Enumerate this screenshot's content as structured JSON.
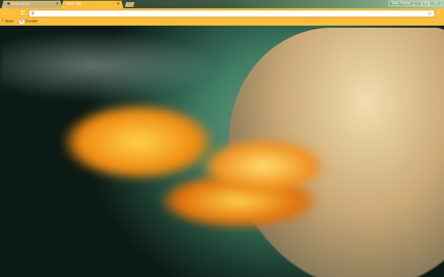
{
  "tabs": [
    {
      "title": "Extensions",
      "icon": "puzzle-icon",
      "active": false
    },
    {
      "title": "New Tab",
      "active": true
    }
  ],
  "window": {
    "profile_label": "New Theme",
    "minimize": "–",
    "maximize": "❐",
    "close": "✕"
  },
  "toolbar": {
    "back": "←",
    "forward": "→",
    "reload": "C",
    "search_icon": "⚲",
    "star": "☆",
    "menu": "≡",
    "url": ""
  },
  "bookmarks": [
    {
      "label": "Apps",
      "icon": "apps-grid-icon"
    },
    {
      "label": "Google",
      "icon": "google-icon"
    }
  ],
  "colors": {
    "frame_accent": "#fbbd3a"
  }
}
